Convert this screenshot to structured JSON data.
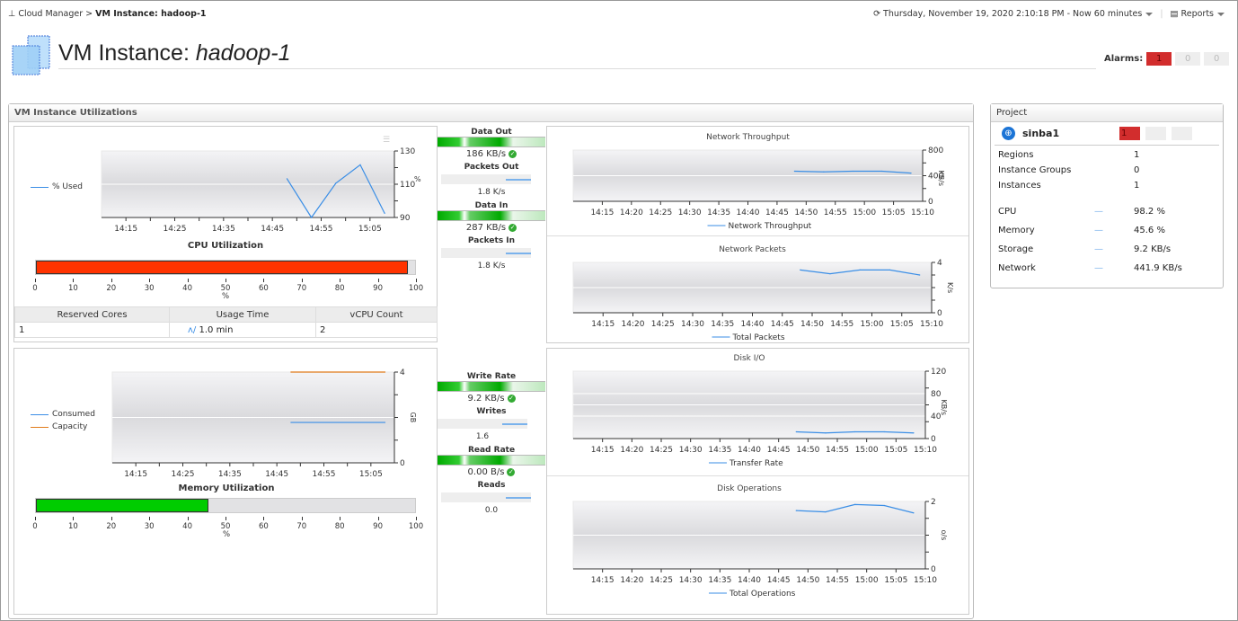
{
  "breadcrumb": {
    "root": "Cloud Manager",
    "separator": ">",
    "current": "VM Instance: hadoop-1"
  },
  "header": {
    "time_range": "Thursday, November 19, 2020 2:10:18 PM - Now 60 minutes",
    "reports": "Reports",
    "title_prefix": "VM Instance:",
    "title_name": "hadoop-1",
    "alarms_label": "Alarms:",
    "alarms": [
      "1",
      "0",
      "0"
    ]
  },
  "colors": {
    "critical": "#d22d2d",
    "cpu_bar": "#ff3300",
    "mem_bar": "#00cc00",
    "series": "#3a8ee6",
    "capacity": "#e07b1a"
  },
  "utilizations": {
    "title": "VM Instance Utilizations",
    "cpu": {
      "legend": "% Used",
      "title": "CPU Utilization",
      "unit": "%",
      "value": 98.2,
      "scale": [
        "0",
        "10",
        "20",
        "30",
        "40",
        "50",
        "60",
        "70",
        "80",
        "90",
        "100"
      ],
      "table": {
        "headers": [
          "Reserved Cores",
          "Usage Time",
          "vCPU Count"
        ],
        "values": [
          "1",
          "1.0 min",
          "2"
        ]
      }
    },
    "memory": {
      "legend": [
        "Consumed",
        "Capacity"
      ],
      "title": "Memory Utilization",
      "unit": "%",
      "value": 45.6,
      "scale": [
        "0",
        "10",
        "20",
        "30",
        "40",
        "50",
        "60",
        "70",
        "80",
        "90",
        "100"
      ]
    },
    "network": {
      "data_out": {
        "label": "Data Out",
        "value": "186 KB/s"
      },
      "packets_out": {
        "label": "Packets Out",
        "value": "1.8 K/s"
      },
      "data_in": {
        "label": "Data In",
        "value": "287 KB/s"
      },
      "packets_in": {
        "label": "Packets In",
        "value": "1.8 K/s"
      }
    },
    "disk": {
      "write_rate": {
        "label": "Write Rate",
        "value": "9.2 KB/s"
      },
      "writes": {
        "label": "Writes",
        "value": "1.6"
      },
      "read_rate": {
        "label": "Read Rate",
        "value": "0.00 B/s"
      },
      "reads": {
        "label": "Reads",
        "value": "0.0"
      }
    }
  },
  "chart_data": [
    {
      "id": "cpu",
      "type": "line",
      "title": "",
      "ylabel": "%",
      "ylim": [
        90,
        130
      ],
      "yticks": [
        "90",
        "110",
        "130"
      ],
      "xlim": [
        "14:10",
        "15:10"
      ],
      "xticks": [
        "14:15",
        "14:25",
        "14:35",
        "14:45",
        "14:55",
        "15:05"
      ],
      "series": [
        {
          "name": "% Used",
          "x": [
            "14:48",
            "14:53",
            "14:58",
            "15:03",
            "15:08"
          ],
          "y": [
            113.3,
            90,
            110.6,
            121.7,
            92.5
          ]
        }
      ]
    },
    {
      "id": "mem",
      "type": "line",
      "title": "",
      "ylabel": "GB",
      "ylim": [
        0,
        4
      ],
      "yticks": [
        "0",
        "4"
      ],
      "xlim": [
        "14:10",
        "15:10"
      ],
      "xticks": [
        "14:15",
        "14:25",
        "14:35",
        "14:45",
        "14:55",
        "15:05"
      ],
      "series": [
        {
          "name": "Consumed",
          "x": [
            "14:48",
            "15:08"
          ],
          "y": [
            1.78,
            1.78
          ]
        },
        {
          "name": "Capacity",
          "x": [
            "14:48",
            "15:08"
          ],
          "y": [
            4,
            4
          ]
        }
      ]
    },
    {
      "id": "netthr",
      "type": "line",
      "title": "Network Throughput",
      "ylabel": "KB/s",
      "ylim": [
        0,
        800
      ],
      "yticks": [
        "0",
        "400",
        "800"
      ],
      "xlim": [
        "14:10",
        "15:10"
      ],
      "xticks": [
        "14:15",
        "14:20",
        "14:25",
        "14:30",
        "14:35",
        "14:40",
        "14:45",
        "14:50",
        "14:55",
        "15:00",
        "15:05",
        "15:10"
      ],
      "series": [
        {
          "name": "Network Throughput",
          "x": [
            "14:48",
            "14:53",
            "14:58",
            "15:03",
            "15:08"
          ],
          "y": [
            470,
            460,
            470,
            470,
            440
          ]
        }
      ]
    },
    {
      "id": "netpk",
      "type": "line",
      "title": "Network Packets",
      "ylabel": "K/s",
      "ylim": [
        0,
        4
      ],
      "yticks": [
        "0",
        "4"
      ],
      "xlim": [
        "14:10",
        "15:10"
      ],
      "xticks": [
        "14:15",
        "14:20",
        "14:25",
        "14:30",
        "14:35",
        "14:40",
        "14:45",
        "14:50",
        "14:55",
        "15:00",
        "15:05",
        "15:10"
      ],
      "series": [
        {
          "name": "Total Packets",
          "x": [
            "14:48",
            "14:53",
            "14:58",
            "15:03",
            "15:08"
          ],
          "y": [
            3.4,
            3.1,
            3.4,
            3.4,
            3.0
          ]
        }
      ]
    },
    {
      "id": "diskio",
      "type": "line",
      "title": "Disk I/O",
      "ylabel": "KB/s",
      "ylim": [
        0,
        120
      ],
      "yticks": [
        "0",
        "40",
        "80",
        "120"
      ],
      "xlim": [
        "14:10",
        "15:10"
      ],
      "xticks": [
        "14:15",
        "14:20",
        "14:25",
        "14:30",
        "14:35",
        "14:40",
        "14:45",
        "14:50",
        "14:55",
        "15:00",
        "15:05",
        "15:10"
      ],
      "series": [
        {
          "name": "Transfer Rate",
          "x": [
            "14:48",
            "14:53",
            "14:58",
            "15:03",
            "15:08"
          ],
          "y": [
            12,
            10,
            12,
            12,
            10
          ]
        }
      ]
    },
    {
      "id": "diskops",
      "type": "line",
      "title": "Disk Operations",
      "ylabel": "o/s",
      "ylim": [
        0,
        2
      ],
      "yticks": [
        "0",
        "2"
      ],
      "xlim": [
        "14:10",
        "15:10"
      ],
      "xticks": [
        "14:15",
        "14:20",
        "14:25",
        "14:30",
        "14:35",
        "14:40",
        "14:45",
        "14:50",
        "14:55",
        "15:00",
        "15:05",
        "15:10"
      ],
      "series": [
        {
          "name": "Total Operations",
          "x": [
            "14:48",
            "14:53",
            "14:58",
            "15:03",
            "15:08"
          ],
          "y": [
            1.73,
            1.69,
            1.91,
            1.88,
            1.66
          ]
        }
      ]
    }
  ],
  "project": {
    "title": "Project",
    "name": "sinba1",
    "alarms": [
      "1",
      "",
      ""
    ],
    "counts": [
      {
        "label": "Regions",
        "value": "1"
      },
      {
        "label": "Instance Groups",
        "value": "0"
      },
      {
        "label": "Instances",
        "value": "1"
      }
    ],
    "metrics": [
      {
        "label": "CPU",
        "value": "98.2 %"
      },
      {
        "label": "Memory",
        "value": "45.6 %"
      },
      {
        "label": "Storage",
        "value": "9.2 KB/s"
      },
      {
        "label": "Network",
        "value": "441.9 KB/s"
      }
    ]
  }
}
